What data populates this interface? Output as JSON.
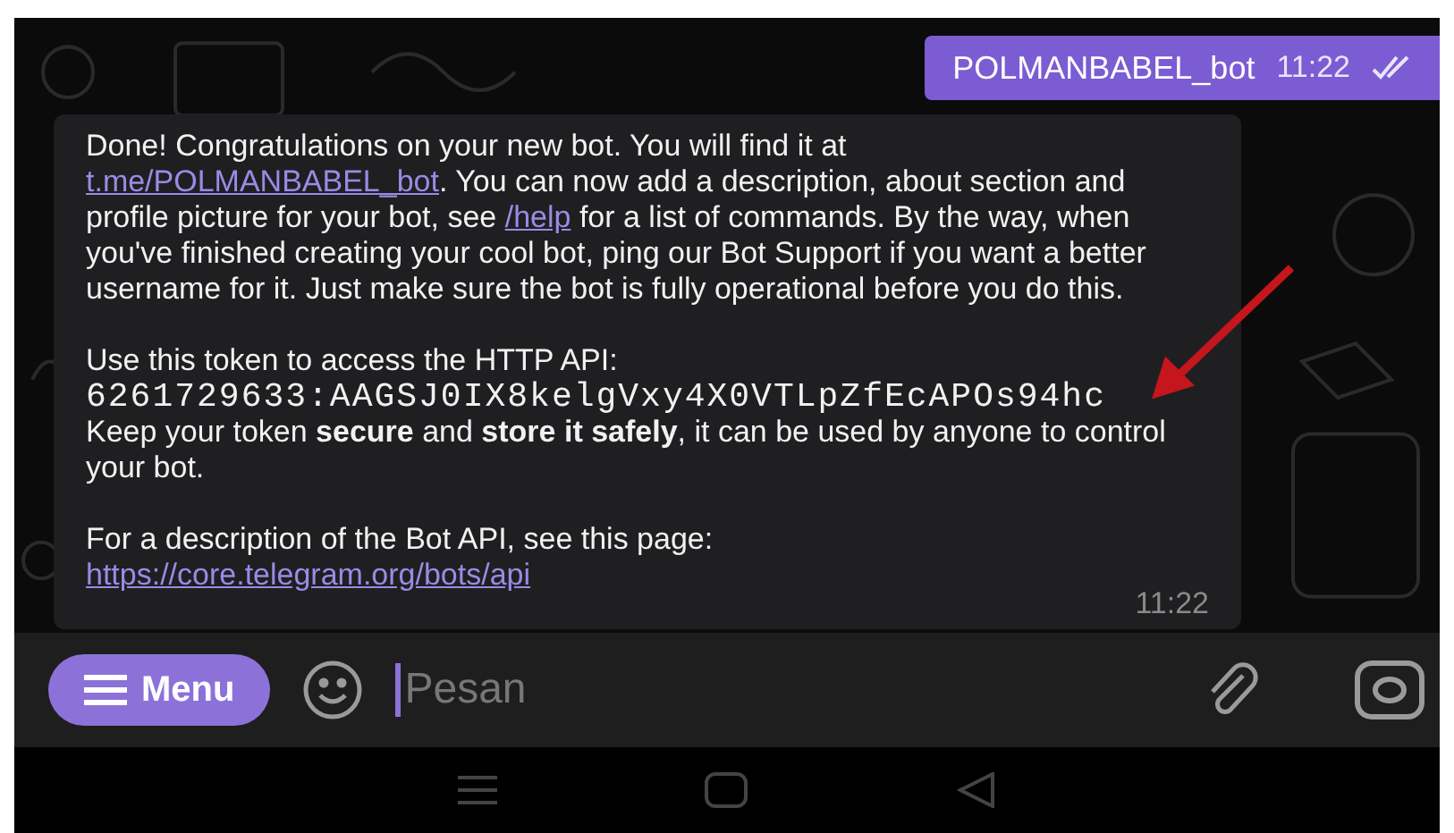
{
  "sent_message": {
    "text": "POLMANBABEL_bot",
    "time": "11:22",
    "read": true
  },
  "received_message": {
    "paragraphs": [
      [
        {
          "kind": "text",
          "segments": [
            {
              "kind": "plain",
              "text": "Done! Congratulations on your new bot. You will find it at "
            },
            {
              "kind": "link",
              "text": "t.me/POLMANBABEL_bot"
            },
            {
              "kind": "plain",
              "text": ". You can now add a description, about section and profile picture for your bot, see "
            },
            {
              "kind": "link",
              "text": "/help"
            },
            {
              "kind": "plain",
              "text": " for a list of commands. By the way, when you've finished creating your cool bot, ping our Bot Support if you want a better username for it. Just make sure the bot is fully operational before you do this."
            }
          ]
        }
      ],
      [
        {
          "kind": "text",
          "segments": [
            {
              "kind": "plain",
              "text": "Use this token to access the HTTP API:"
            }
          ]
        },
        {
          "kind": "code",
          "text": "6261729633:AAGSJ0IX8kelgVxy4X0VTLpZfEcAPOs94hc"
        },
        {
          "kind": "text",
          "segments": [
            {
              "kind": "plain",
              "text": "Keep your token **secure** and **store it safely**, it can be used by anyone to control your bot."
            }
          ]
        }
      ],
      [
        {
          "kind": "text",
          "segments": [
            {
              "kind": "plain",
              "text": "For a description of the Bot API, see this page:"
            }
          ]
        },
        {
          "kind": "text",
          "segments": [
            {
              "kind": "link",
              "text": "https://core.telegram.org/bots/api"
            }
          ]
        }
      ]
    ],
    "time": "11:22"
  },
  "composer": {
    "menu_button": "Menu",
    "placeholder": "Pesan"
  }
}
